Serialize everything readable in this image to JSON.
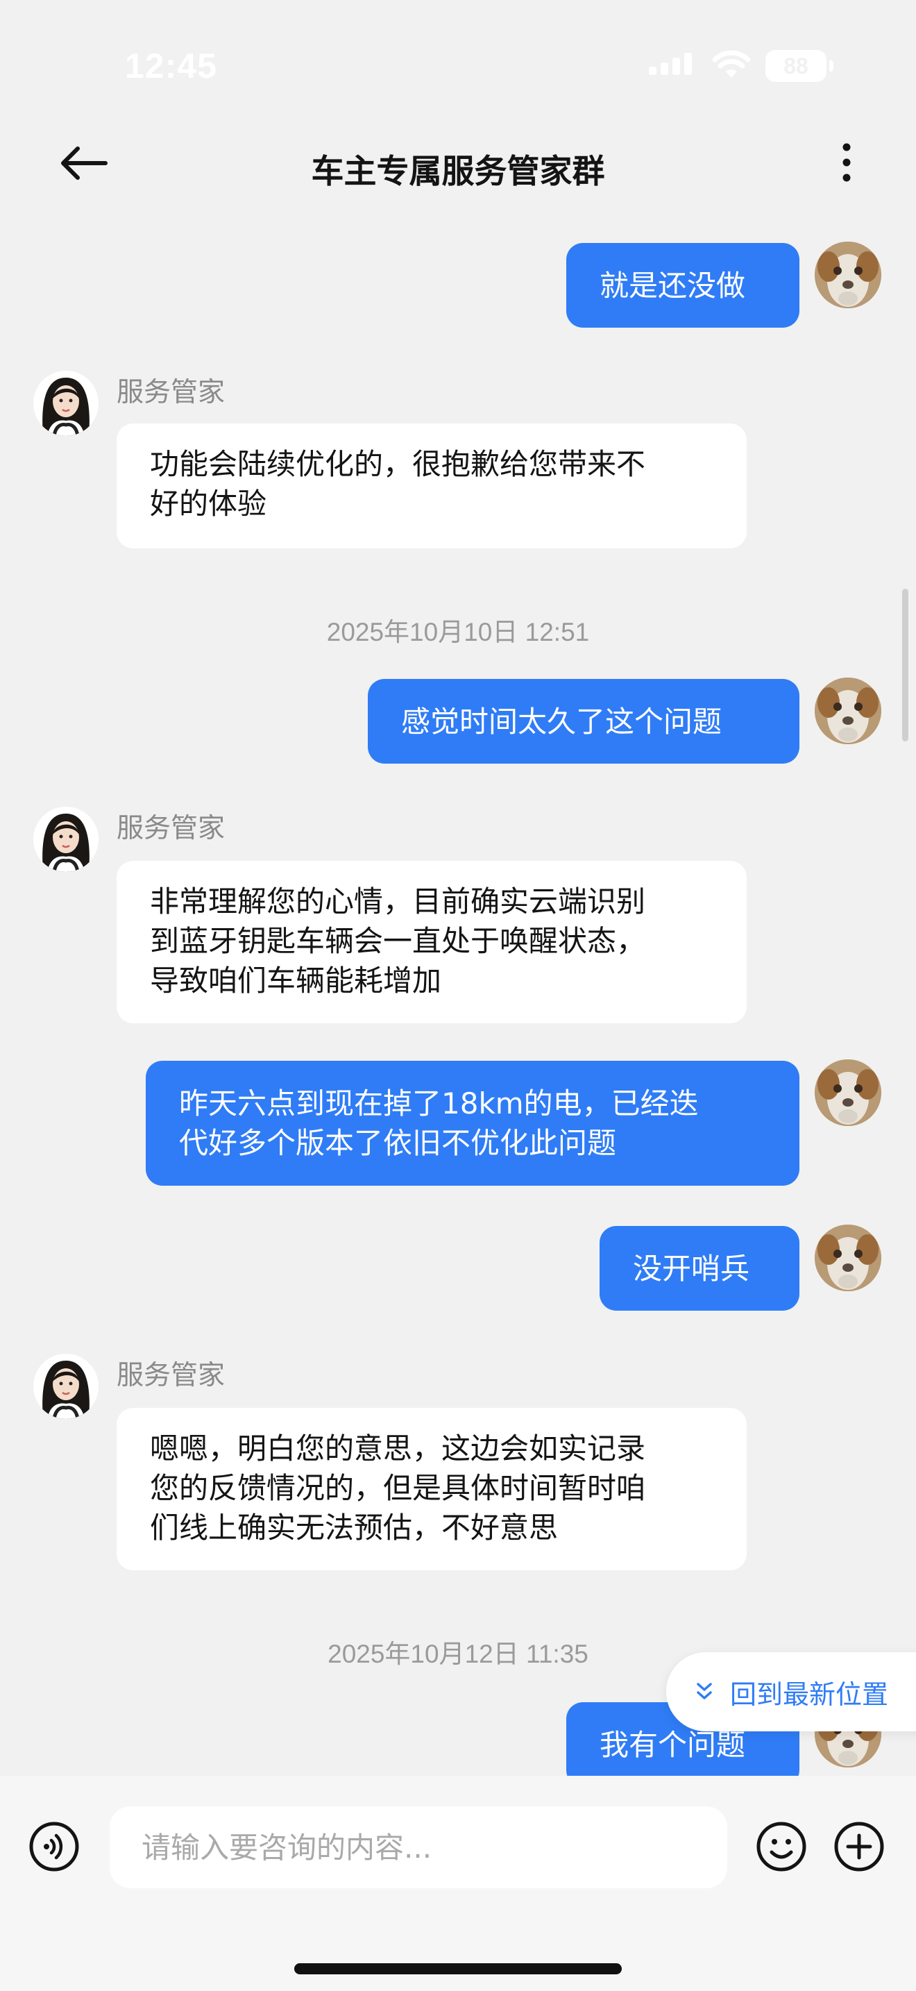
{
  "status_bar": {
    "time": "12:45",
    "battery": "88"
  },
  "header": {
    "title": "车主专属服务管家群"
  },
  "messages": {
    "m1": "就是还没做",
    "m2_sender": "服务管家",
    "m2_line1": "功能会陆续优化的，很抱歉给您带来不",
    "m2_line2": "好的体验",
    "ts1": "2025年10月10日 12:51",
    "m3": "感觉时间太久了这个问题",
    "m4_sender": "服务管家",
    "m4_line1": "非常理解您的心情，目前确实云端识别",
    "m4_line2": "到蓝牙钥匙车辆会一直处于唤醒状态，",
    "m4_line3": "导致咱们车辆能耗增加",
    "m5_line1": "昨天六点到现在掉了18km的电，已经迭",
    "m5_line2": "代好多个版本了依旧不优化此问题",
    "m6": "没开哨兵",
    "m7_sender": "服务管家",
    "m7_line1": "嗯嗯，明白您的意思，这边会如实记录",
    "m7_line2": "您的反馈情况的，但是具体时间暂时咱",
    "m7_line3": "们线上确实无法预估，不好意思",
    "ts2": "2025年10月12日 11:35",
    "m8": "我有个问题"
  },
  "jump_latest": {
    "label": "回到最新位置"
  },
  "input": {
    "placeholder": "请输入要咨询的内容..."
  },
  "colors": {
    "accent": "#2f7cf6",
    "background": "#f1f1f1"
  }
}
